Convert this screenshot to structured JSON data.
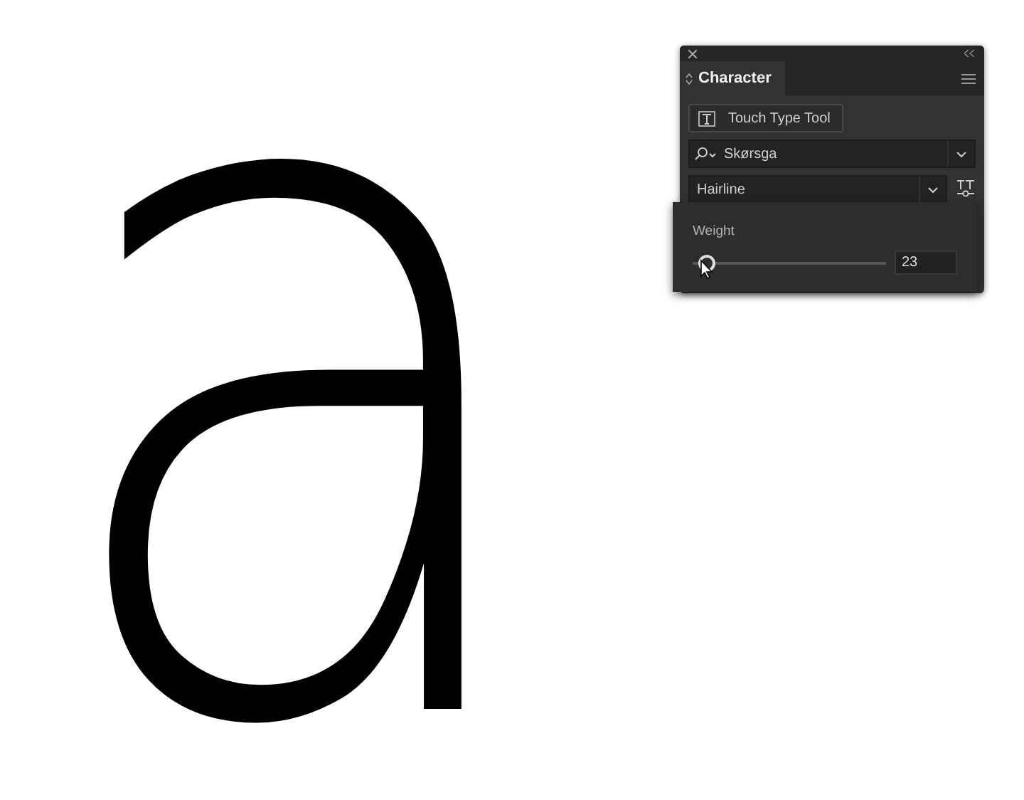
{
  "canvas_text": "a",
  "panel": {
    "title": "Character",
    "touch_type_button": "Touch Type Tool",
    "font_family": "Skørsga",
    "font_style": "Hairline"
  },
  "weight_popup": {
    "label": "Weight",
    "level": 0.03,
    "value": "23"
  }
}
